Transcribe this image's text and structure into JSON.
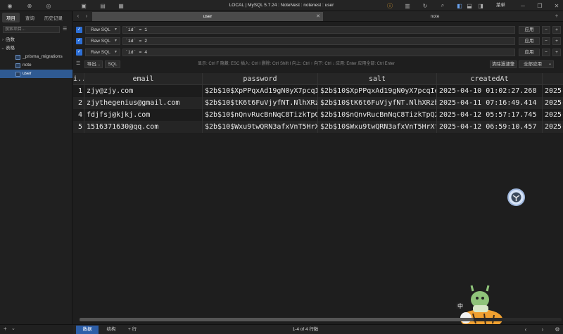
{
  "titlebar": {
    "title": "LOCAL | MySQL 5.7.24 : NoteNest : notenest : user",
    "menu_label": "菜单",
    "icons": [
      "target-icon",
      "close-circle-icon",
      "eye-icon",
      "lock-icon",
      "archive-icon",
      "terminal-icon"
    ]
  },
  "sidebar": {
    "tabs": [
      "项目",
      "查询",
      "历史记录"
    ],
    "search_placeholder": "搜索项目...",
    "tree": {
      "functions": "函数",
      "tables": "表格",
      "items": [
        "_prisma_migrations",
        "note",
        "user"
      ]
    }
  },
  "tabs": [
    {
      "label": "user",
      "active": true
    },
    {
      "label": "note",
      "active": false
    }
  ],
  "filters": [
    {
      "mode": "Raw SQL",
      "expr": "`id` = 1",
      "apply": "应用"
    },
    {
      "mode": "Raw SQL",
      "expr": "`id` = 2",
      "apply": "应用"
    },
    {
      "mode": "Raw SQL",
      "expr": "`id` = 4",
      "apply": "应用"
    }
  ],
  "toolbar": {
    "export": "导出...",
    "sql": "SQL",
    "hint": "显示: Ctrl F 隐藏: ESC 插入: Ctrl I 删除: Ctrl Shift I 向上: Ctrl ↑ 向下: Ctrl ↓ 应用: Enter 应用全部: Ctrl Enter",
    "clear_filter": "清除過濾筆",
    "apply_all": "全部应用"
  },
  "grid": {
    "columns": [
      "i...",
      "email",
      "password",
      "salt",
      "createdAt",
      "2025-"
    ],
    "rows": [
      {
        "id": "1",
        "email": "zjy@zjy.com",
        "password": "$2b$10$XpPPqxAd19gN0yX7pcqIeu",
        "salt": "$2b$10$XpPPqxAd19gN0yX7pcqIeu",
        "createdAt": "2025-04-10 01:02:27.268",
        "updatedAt": "2025-"
      },
      {
        "id": "2",
        "email": "zjythegenius@gmail.com",
        "password": "$2b$10$tK6t6FuVjyfNT.NlhXRzbe",
        "salt": "$2b$10$tK6t6FuVjyfNT.NlhXRzbe",
        "createdAt": "2025-04-11 07:16:49.414",
        "updatedAt": "2025-"
      },
      {
        "id": "4",
        "email": "fdjfsj@kjkj.com",
        "password": "$2b$10$nQnvRucBnNqC8TizkTpQ2u",
        "salt": "$2b$10$nQnvRucBnNqC8TizkTpQ2u",
        "createdAt": "2025-04-12 05:57:17.745",
        "updatedAt": "2025-"
      },
      {
        "id": "5",
        "email": "1516371630@qq.com",
        "password": "$2b$10$Wxu9twQRN3afxVnT5HrXfe",
        "salt": "$2b$10$Wxu9twQRN3afxVnT5HrXfe",
        "createdAt": "2025-04-12 06:59:10.457",
        "updatedAt": "2025-"
      }
    ]
  },
  "bottombar": {
    "tabs": [
      "数据",
      "结构"
    ],
    "add_row": "+ 行",
    "status": "1-4 of 4 行数"
  },
  "mascot_label": "中",
  "colors": {
    "accent": "#2d6fd6",
    "selected": "#2f5a92",
    "active_tab": "#4a4a4a"
  }
}
